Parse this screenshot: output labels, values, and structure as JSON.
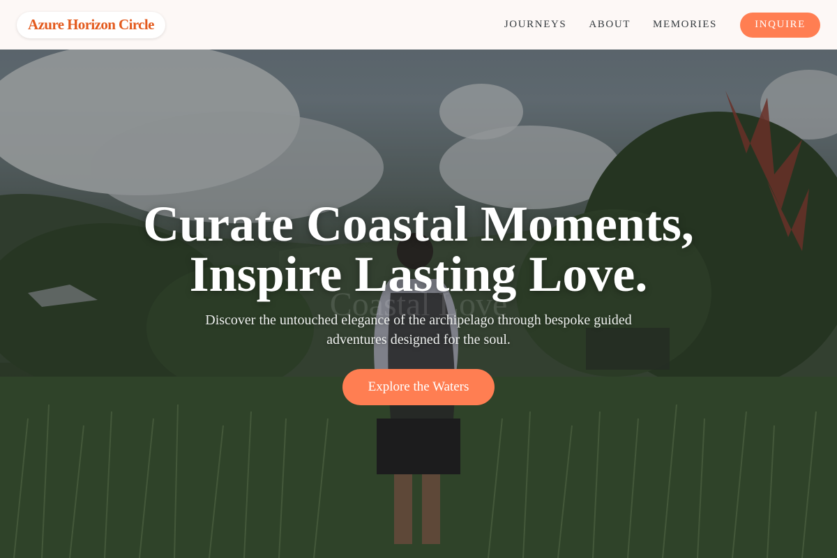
{
  "header": {
    "brand": "Azure Horizon Circle",
    "nav": [
      "JOURNEYS",
      "ABOUT",
      "MEMORIES"
    ],
    "cta": "INQUIRE"
  },
  "hero": {
    "title_line1": "Curate Coastal Moments,",
    "title_line2": "Inspire Lasting Love.",
    "ghost_text": "Coastal Love",
    "subtitle": "Discover the untouched elegance of the archipelago through bespoke guided adventures designed for the soul.",
    "cta": "Explore the Waters",
    "background_icon": "rice-field-traveler-photo"
  },
  "colors": {
    "accent": "#ff7e52",
    "brand": "#e35a1d",
    "header_bg": "#fdf8f6",
    "nav_text": "#33393d"
  }
}
